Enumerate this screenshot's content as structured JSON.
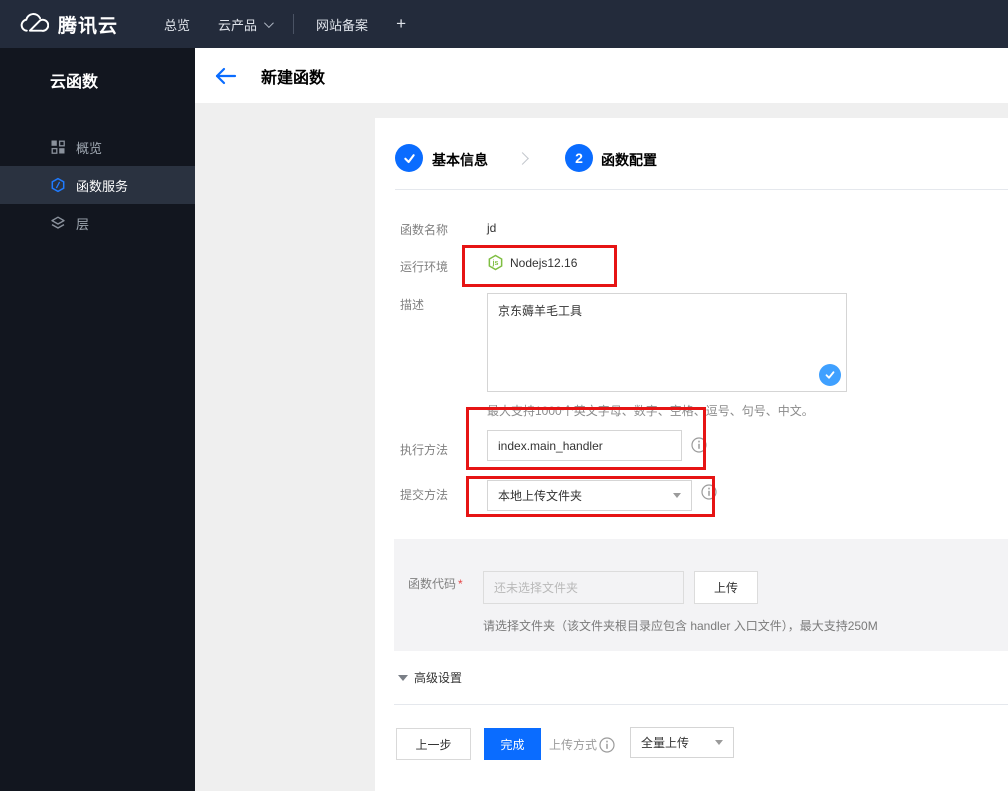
{
  "topbar": {
    "brand": "腾讯云",
    "nav": [
      {
        "label": "总览"
      },
      {
        "label": "云产品"
      },
      {
        "label": "网站备案"
      },
      {
        "label": "+"
      }
    ]
  },
  "sidebar": {
    "title": "云函数",
    "items": [
      {
        "label": "概览",
        "icon": "grid-icon",
        "active": false
      },
      {
        "label": "函数服务",
        "icon": "scf-hexagon-icon",
        "active": true
      },
      {
        "label": "层",
        "icon": "layers-icon",
        "active": false
      }
    ]
  },
  "header": {
    "title": "新建函数"
  },
  "steps": [
    {
      "label": "基本信息",
      "state": "done",
      "icon": "check-icon"
    },
    {
      "label": "函数配置",
      "number": "2",
      "state": "current"
    }
  ],
  "form": {
    "function_name": {
      "label": "函数名称",
      "value": "jd"
    },
    "runtime": {
      "label": "运行环境",
      "value": "Nodejs12.16",
      "icon": "nodejs-icon"
    },
    "description": {
      "label": "描述",
      "value": "京东薅羊毛工具",
      "helper": "最大支持1000个英文字母、数字、空格、逗号、句号、中文。"
    },
    "handler": {
      "label": "执行方法",
      "value": "index.main_handler"
    },
    "submit_method": {
      "label": "提交方法",
      "value": "本地上传文件夹"
    },
    "function_code": {
      "label": "函数代码",
      "required_mark": "*",
      "placeholder": "还未选择文件夹",
      "upload_button": "上传",
      "helper": "请选择文件夹（该文件夹根目录应包含 handler 入口文件），最大支持250M"
    },
    "advanced_label": "高级设置"
  },
  "footer": {
    "prev_button": "上一步",
    "finish_button": "完成",
    "upload_mode_label": "上传方式",
    "upload_mode_value": "全量上传"
  },
  "colors": {
    "accent_blue": "#0a6cff",
    "check_blue": "#3fa0ff",
    "node_green": "#7fbe42",
    "annotation_red": "#e61414",
    "topbar_bg": "#232b3b",
    "sidebar_bg": "#12161f"
  }
}
